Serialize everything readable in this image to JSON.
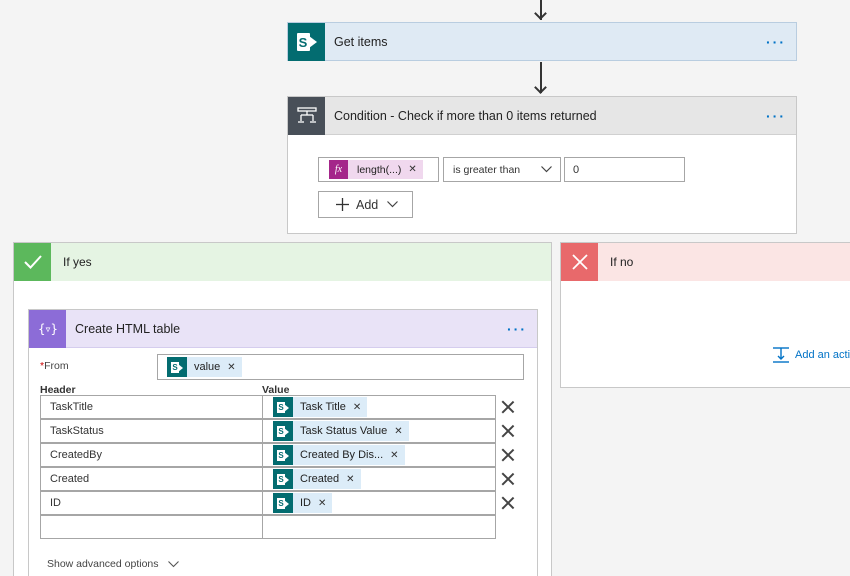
{
  "get_items": {
    "title": "Get items",
    "more": "···"
  },
  "condition": {
    "title": "Condition - Check if more than 0 items returned",
    "more": "···",
    "left_token": "length(...)",
    "fx_label": "fx",
    "operator": "is greater than",
    "right_value": "0",
    "add_label": "Add"
  },
  "if_yes": {
    "label": "If yes"
  },
  "if_no": {
    "label": "If no",
    "add_action": "Add an actio"
  },
  "html_table": {
    "title": "Create HTML table",
    "more": "···",
    "from_label": "From",
    "required_mark": "*",
    "from_token": "value",
    "header_col": "Header",
    "value_col": "Value",
    "rows": [
      {
        "header": "TaskTitle",
        "value": "Task Title"
      },
      {
        "header": "TaskStatus",
        "value": "Task Status Value"
      },
      {
        "header": "CreatedBy",
        "value": "Created By Dis..."
      },
      {
        "header": "Created",
        "value": "Created"
      },
      {
        "header": "ID",
        "value": "ID"
      }
    ],
    "advanced": "Show advanced options"
  },
  "colors": {
    "sharepoint": "#036c70",
    "condition_tile": "#484f58",
    "yes_green": "#5cb85c",
    "no_red": "#e8696b",
    "data_op_purple": "#8c6cd7",
    "link_blue": "#0072c6"
  }
}
